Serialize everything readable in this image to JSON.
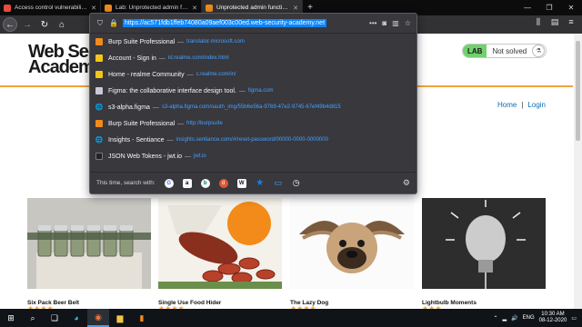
{
  "tabs": [
    {
      "title": "Access control vulnerabilities a...",
      "active": false,
      "color": "#e64e3c"
    },
    {
      "title": "Lab: Unprotected admin functi...",
      "active": false,
      "color": "#f28b1a"
    },
    {
      "title": "Unprotected admin functionali...",
      "active": true,
      "color": "#f28b1a"
    }
  ],
  "url_bar": {
    "url": "https://ac571fdb1ffeb74080a09aef003c00ed.web-security-academy.net"
  },
  "suggestions": [
    {
      "title": "Burp Suite Professional",
      "url": "translator.microsoft.com",
      "icon": "burp-icon"
    },
    {
      "title": "Account - Sign in",
      "url": "id.realme.com/index.html",
      "icon": "realme-icon"
    },
    {
      "title": "Home - realme Community",
      "url": "c.realme.com/in/",
      "icon": "realme-icon"
    },
    {
      "title": "Figma: the collaborative interface design tool.",
      "url": "figma.com",
      "icon": "figma-icon"
    },
    {
      "title": "s3-alpha.figma",
      "url": "s3-alpha.figma.com/oauth_img/55b6e56a-9769-47e2-9745-67ef49b4d815",
      "icon": "globe-icon"
    },
    {
      "title": "Burp Suite Professional",
      "url": "http://burpsuite",
      "icon": "burp-icon"
    },
    {
      "title": "Insights - Sentiance",
      "url": "insights.sentiance.com/#/reset-password/00000-0000-0000000",
      "icon": "globe-icon"
    },
    {
      "title": "JSON Web Tokens - jwt.io",
      "url": "jwt.io",
      "icon": "jwt-icon"
    }
  ],
  "separator": "—",
  "search_with_label": "This time, search with:",
  "logo": {
    "line1": "Web Secu",
    "line2": "Academy"
  },
  "lab": {
    "tag": "LAB",
    "status": "Not solved"
  },
  "nav": {
    "home": "Home",
    "divider": "|",
    "login": "Login"
  },
  "products": [
    {
      "title": "Six Pack Beer Belt",
      "rating": 4
    },
    {
      "title": "Single Use Food Hider",
      "rating": 4
    },
    {
      "title": "The Lazy Dog",
      "rating": 4
    },
    {
      "title": "Lightbulb Moments",
      "rating": 3
    }
  ],
  "taskbar": {
    "lang": "ENG",
    "time": "10:30 AM",
    "date": "08-12-2020"
  },
  "colors": {
    "accent": "#0a84ff",
    "lab_green": "#70d16d",
    "orange": "#f2a33a",
    "link": "#0a6cb8"
  }
}
